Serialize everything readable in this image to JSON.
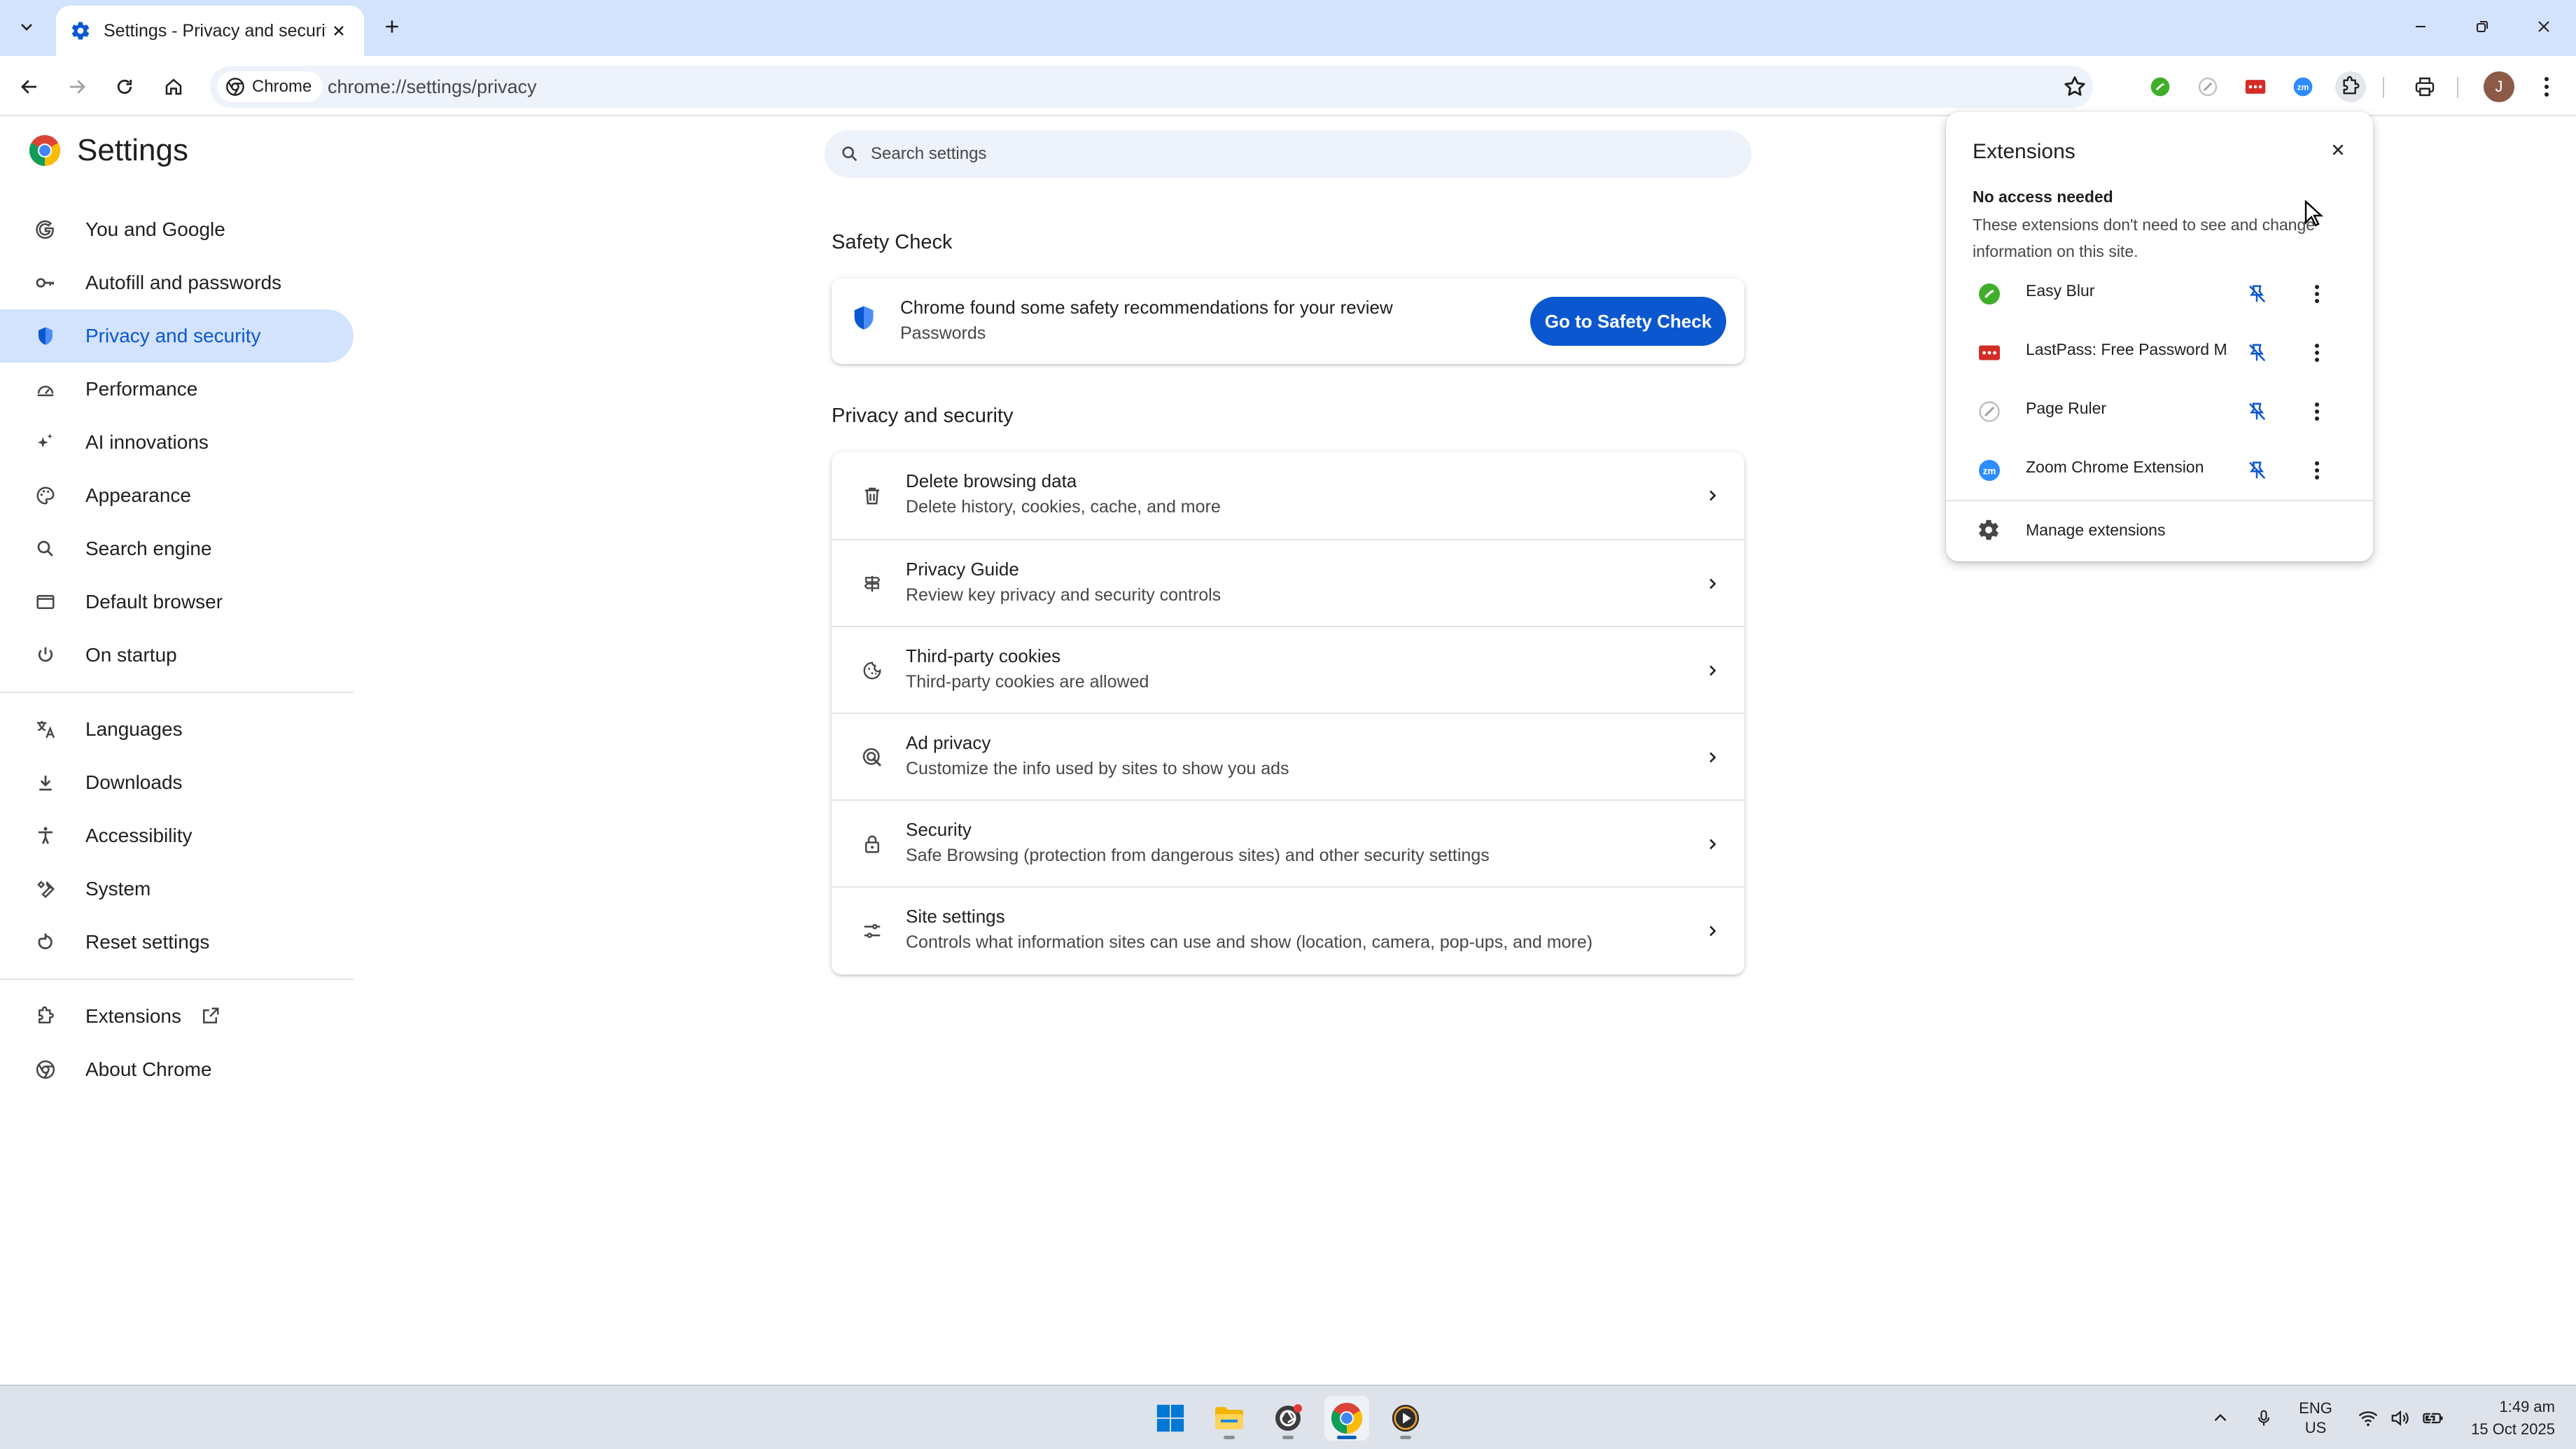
{
  "browser": {
    "tab": {
      "title": "Settings - Privacy and security"
    },
    "address": {
      "chip_label": "Chrome",
      "url": "chrome://settings/privacy"
    },
    "avatar_initial": "J",
    "extension_icons": [
      "easy-blur-icon",
      "page-ruler-icon",
      "lastpass-icon",
      "zoom-icon"
    ]
  },
  "settings": {
    "title": "Settings",
    "search_placeholder": "Search settings",
    "sidebar": {
      "items": [
        {
          "label": "You and Google",
          "icon": "google-icon"
        },
        {
          "label": "Autofill and passwords",
          "icon": "key-icon"
        },
        {
          "label": "Privacy and security",
          "icon": "shield-icon",
          "active": true
        },
        {
          "label": "Performance",
          "icon": "speedometer-icon"
        },
        {
          "label": "AI innovations",
          "icon": "sparkle-icon"
        },
        {
          "label": "Appearance",
          "icon": "palette-icon"
        },
        {
          "label": "Search engine",
          "icon": "search-icon"
        },
        {
          "label": "Default browser",
          "icon": "browser-window-icon"
        },
        {
          "label": "On startup",
          "icon": "power-icon"
        }
      ],
      "advanced": [
        {
          "label": "Languages",
          "icon": "translate-icon"
        },
        {
          "label": "Downloads",
          "icon": "download-icon"
        },
        {
          "label": "Accessibility",
          "icon": "accessibility-icon"
        },
        {
          "label": "System",
          "icon": "wrench-icon"
        },
        {
          "label": "Reset settings",
          "icon": "reset-icon"
        }
      ],
      "footer": [
        {
          "label": "Extensions",
          "icon": "puzzle-icon"
        },
        {
          "label": "About Chrome",
          "icon": "chrome-icon"
        }
      ]
    },
    "safety_check": {
      "heading": "Safety Check",
      "title": "Chrome found some safety recommendations for your review",
      "subtitle": "Passwords",
      "button": "Go to Safety Check"
    },
    "privacy": {
      "heading": "Privacy and security",
      "rows": [
        {
          "title": "Delete browsing data",
          "subtitle": "Delete history, cookies, cache, and more",
          "icon": "trash-icon"
        },
        {
          "title": "Privacy Guide",
          "subtitle": "Review key privacy and security controls",
          "icon": "signpost-icon"
        },
        {
          "title": "Third-party cookies",
          "subtitle": "Third-party cookies are allowed",
          "icon": "cookie-icon"
        },
        {
          "title": "Ad privacy",
          "subtitle": "Customize the info used by sites to show you ads",
          "icon": "ad-privacy-icon"
        },
        {
          "title": "Security",
          "subtitle": "Safe Browsing (protection from dangerous sites) and other security settings",
          "icon": "lock-icon"
        },
        {
          "title": "Site settings",
          "subtitle": "Controls what information sites can use and show (location, camera, pop-ups, and more)",
          "icon": "tune-icon"
        }
      ]
    }
  },
  "extensions_popup": {
    "title": "Extensions",
    "section_heading": "No access needed",
    "section_desc": "These extensions don't need to see and change information on this site.",
    "items": [
      {
        "name": "Easy Blur",
        "icon": "easy-blur-icon",
        "color": "#3fae29"
      },
      {
        "name": "LastPass: Free Password M...",
        "icon": "lastpass-icon",
        "color": "#d32d27"
      },
      {
        "name": "Page Ruler",
        "icon": "page-ruler-icon",
        "color": "#9aa0a6"
      },
      {
        "name": "Zoom Chrome Extension",
        "icon": "zoom-icon",
        "color": "#2d8cff"
      }
    ],
    "manage_label": "Manage extensions"
  },
  "taskbar": {
    "apps": [
      "windows-start-icon",
      "file-explorer-icon",
      "camera-app-icon",
      "chrome-icon",
      "media-player-icon"
    ],
    "language": {
      "line1": "ENG",
      "line2": "US"
    },
    "time": "1:49 am",
    "date": "15 Oct 2025"
  },
  "colors": {
    "accent": "#0b57d0",
    "active_nav": "#d3e3fd",
    "titlebar": "#d3e3fd"
  }
}
